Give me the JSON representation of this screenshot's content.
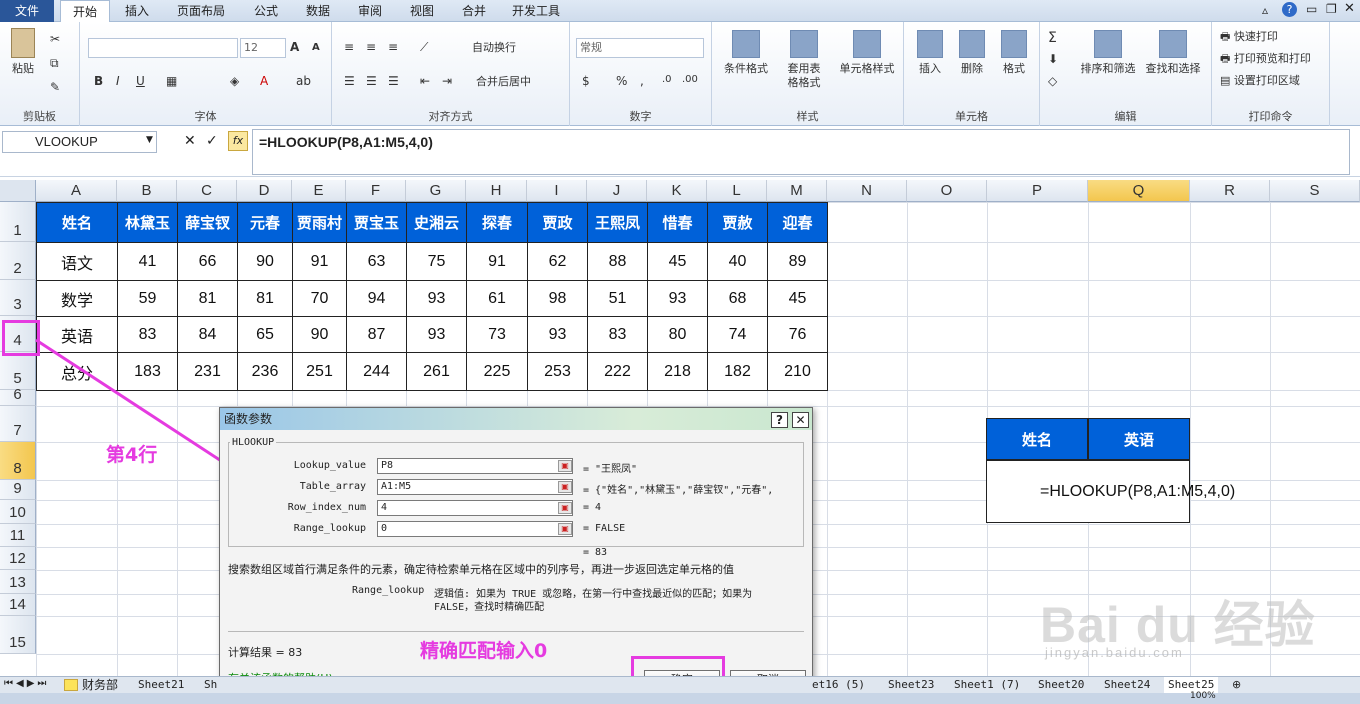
{
  "ribbon": {
    "tabs": [
      "文件",
      "开始",
      "插入",
      "页面布局",
      "公式",
      "数据",
      "审阅",
      "视图",
      "合并",
      "开发工具"
    ],
    "groups": {
      "clipboard": {
        "label": "剪贴板",
        "paste": "粘贴"
      },
      "font": {
        "label": "字体",
        "font_size": "12"
      },
      "alignment": {
        "label": "对齐方式",
        "wrap": "自动换行",
        "merge": "合并后居中"
      },
      "number": {
        "label": "数字",
        "format": "常规"
      },
      "styles": {
        "label": "样式",
        "conditional": "条件格式",
        "table_format": "套用表格格式",
        "cell_style": "单元格样式"
      },
      "cells": {
        "label": "单元格",
        "insert": "插入",
        "delete": "删除",
        "format": "格式"
      },
      "editing": {
        "label": "编辑",
        "sort": "排序和筛选",
        "find": "查找和选择"
      },
      "print": {
        "label": "打印命令",
        "quick_print": "快速打印",
        "preview": "打印预览和打印",
        "area": "设置打印区域"
      }
    }
  },
  "formula_bar": {
    "name_box": "VLOOKUP",
    "fx": "fx",
    "formula": "=HLOOKUP(P8,A1:M5,4,0)"
  },
  "grid": {
    "columns": [
      "A",
      "B",
      "C",
      "D",
      "E",
      "F",
      "G",
      "H",
      "I",
      "J",
      "K",
      "L",
      "M",
      "N",
      "O",
      "P",
      "Q",
      "R",
      "S"
    ],
    "rows": [
      "1",
      "2",
      "3",
      "4",
      "5",
      "6",
      "7",
      "8",
      "9",
      "10",
      "11",
      "12",
      "13",
      "14",
      "15"
    ],
    "table": {
      "header": [
        "姓名",
        "林黛玉",
        "薛宝钗",
        "元春",
        "贾雨村",
        "贾宝玉",
        "史湘云",
        "探春",
        "贾政",
        "王熙凤",
        "惜春",
        "贾赦",
        "迎春"
      ],
      "rows": [
        [
          "语文",
          "41",
          "66",
          "90",
          "91",
          "63",
          "75",
          "91",
          "62",
          "88",
          "45",
          "40",
          "89"
        ],
        [
          "数学",
          "59",
          "81",
          "81",
          "70",
          "94",
          "93",
          "61",
          "98",
          "51",
          "93",
          "68",
          "45"
        ],
        [
          "英语",
          "83",
          "84",
          "65",
          "90",
          "87",
          "93",
          "73",
          "93",
          "83",
          "80",
          "74",
          "76"
        ],
        [
          "总分",
          "183",
          "231",
          "236",
          "251",
          "244",
          "261",
          "225",
          "253",
          "222",
          "218",
          "182",
          "210"
        ]
      ]
    },
    "lookup": {
      "header_name": "姓名",
      "header_english": "英语",
      "formula_cell": "=HLOOKUP(P8,A1:M5,4,0)"
    }
  },
  "dialog": {
    "title": "函数参数",
    "help_btn": "?",
    "close_btn": "✕",
    "function_name": "HLOOKUP",
    "args": [
      {
        "label": "Lookup_value",
        "value": "P8",
        "result": "= \"王熙凤\""
      },
      {
        "label": "Table_array",
        "value": "A1:M5",
        "result": "= {\"姓名\",\"林黛玉\",\"薛宝钗\",\"元春\","
      },
      {
        "label": "Row_index_num",
        "value": "4",
        "result": "= 4"
      },
      {
        "label": "Range_lookup",
        "value": "0",
        "result": "= FALSE"
      }
    ],
    "total_result": "= 83",
    "description": "搜索数组区域首行满足条件的元素，确定待检索单元格在区域中的列序号，再进一步返回选定单元格的值",
    "arg_help_label": "Range_lookup",
    "arg_help_text1": "逻辑值: 如果为 TRUE 或忽略，在第一行中查找最近似的匹配；如果为",
    "arg_help_text2": "FALSE，查找时精确匹配",
    "calc_result": "计算结果 =  83",
    "help_link": "有关该函数的帮助(H)",
    "ok": "确定",
    "cancel": "取消"
  },
  "annotations": {
    "row4": "第4行",
    "exact": "精确匹配输入0",
    "color": "#e53be0"
  },
  "sheet_tabs": [
    "财务部",
    "Sheet21",
    "Sh",
    "et16 (5)",
    "Sheet23",
    "Sheet1 (7)",
    "Sheet20",
    "Sheet24",
    "Sheet25"
  ],
  "status": {
    "zoom": "100%"
  },
  "watermark": {
    "text": "Bai du 经验",
    "url": "jingyan.baidu.com"
  }
}
